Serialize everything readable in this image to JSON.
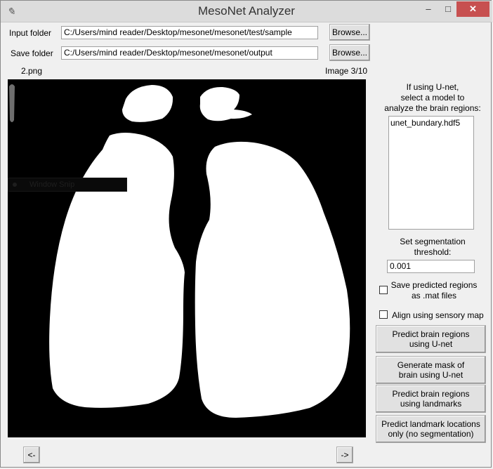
{
  "window": {
    "title": "MesoNet Analyzer",
    "controls": {
      "minimize": "–",
      "maximize": "□",
      "close": "✕"
    }
  },
  "input_folder": {
    "label": "Input folder",
    "value": "C:/Users/mind reader/Desktop/mesonet/mesonet/test/sample",
    "browse_label": "Browse..."
  },
  "save_folder": {
    "label": "Save folder",
    "value": "C:/Users/mind reader/Desktop/mesonet/mesonet/output",
    "browse_label": "Browse..."
  },
  "image": {
    "filename": "2.png",
    "counter": "Image 3/10",
    "overlay_text": "Window Snip"
  },
  "unet": {
    "instruction": "If using U-net,\nselect a model to\nanalyze the brain regions:",
    "models": [
      "unet_bundary.hdf5"
    ]
  },
  "threshold": {
    "label": "Set segmentation\nthreshold:",
    "value": "0.001"
  },
  "options": {
    "save_mat_label": "Save predicted regions\nas .mat files",
    "save_mat_checked": false,
    "align_label": "Align using sensory map",
    "align_checked": false
  },
  "actions": {
    "predict_unet": "Predict brain regions\nusing U-net",
    "generate_mask": "Generate mask of\nbrain using U-net",
    "predict_landmarks": "Predict brain regions\nusing landmarks",
    "predict_landmark_locations": "Predict landmark locations\nonly (no segmentation)"
  },
  "nav": {
    "prev": "<-",
    "next": "->"
  }
}
